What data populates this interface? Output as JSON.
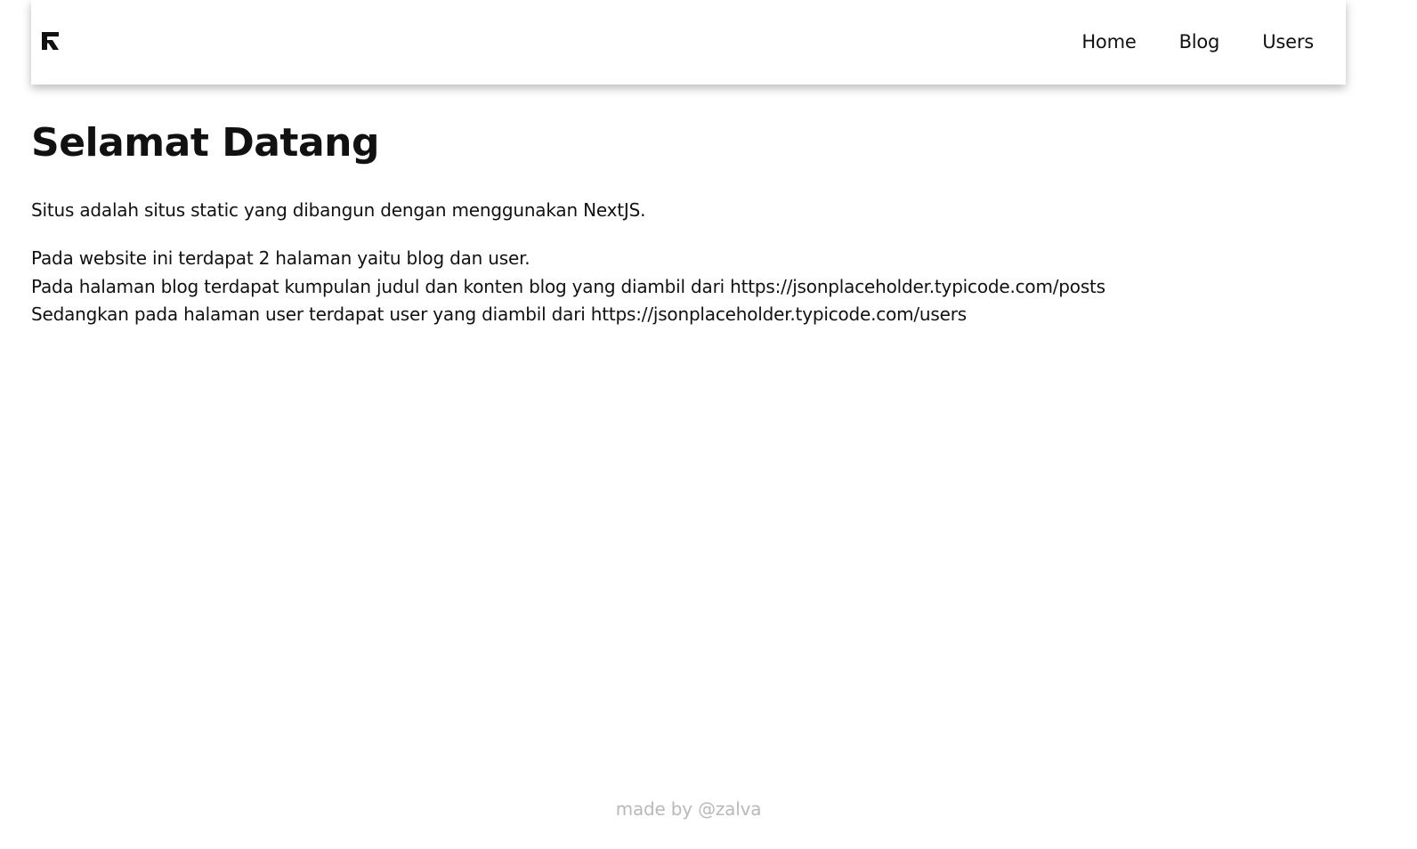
{
  "navbar": {
    "logo_icon": "r-letter-logo-icon",
    "links": [
      {
        "label": "Home"
      },
      {
        "label": "Blog"
      },
      {
        "label": "Users"
      }
    ]
  },
  "main": {
    "title": "Selamat Datang",
    "intro": "Situs adalah situs static yang dibangun dengan menggunakan NextJS.",
    "details": [
      "Pada website ini terdapat 2 halaman yaitu blog dan user.",
      "Pada halaman blog terdapat kumpulan judul dan konten blog yang diambil dari https://jsonplaceholder.typicode.com/posts",
      "Sedangkan pada halaman user terdapat user yang diambil dari https://jsonplaceholder.typicode.com/users"
    ]
  },
  "footer": {
    "text": "made by @zalva"
  },
  "colors": {
    "text": "#111111",
    "footer_text": "#b9b9b9",
    "background": "#ffffff"
  }
}
